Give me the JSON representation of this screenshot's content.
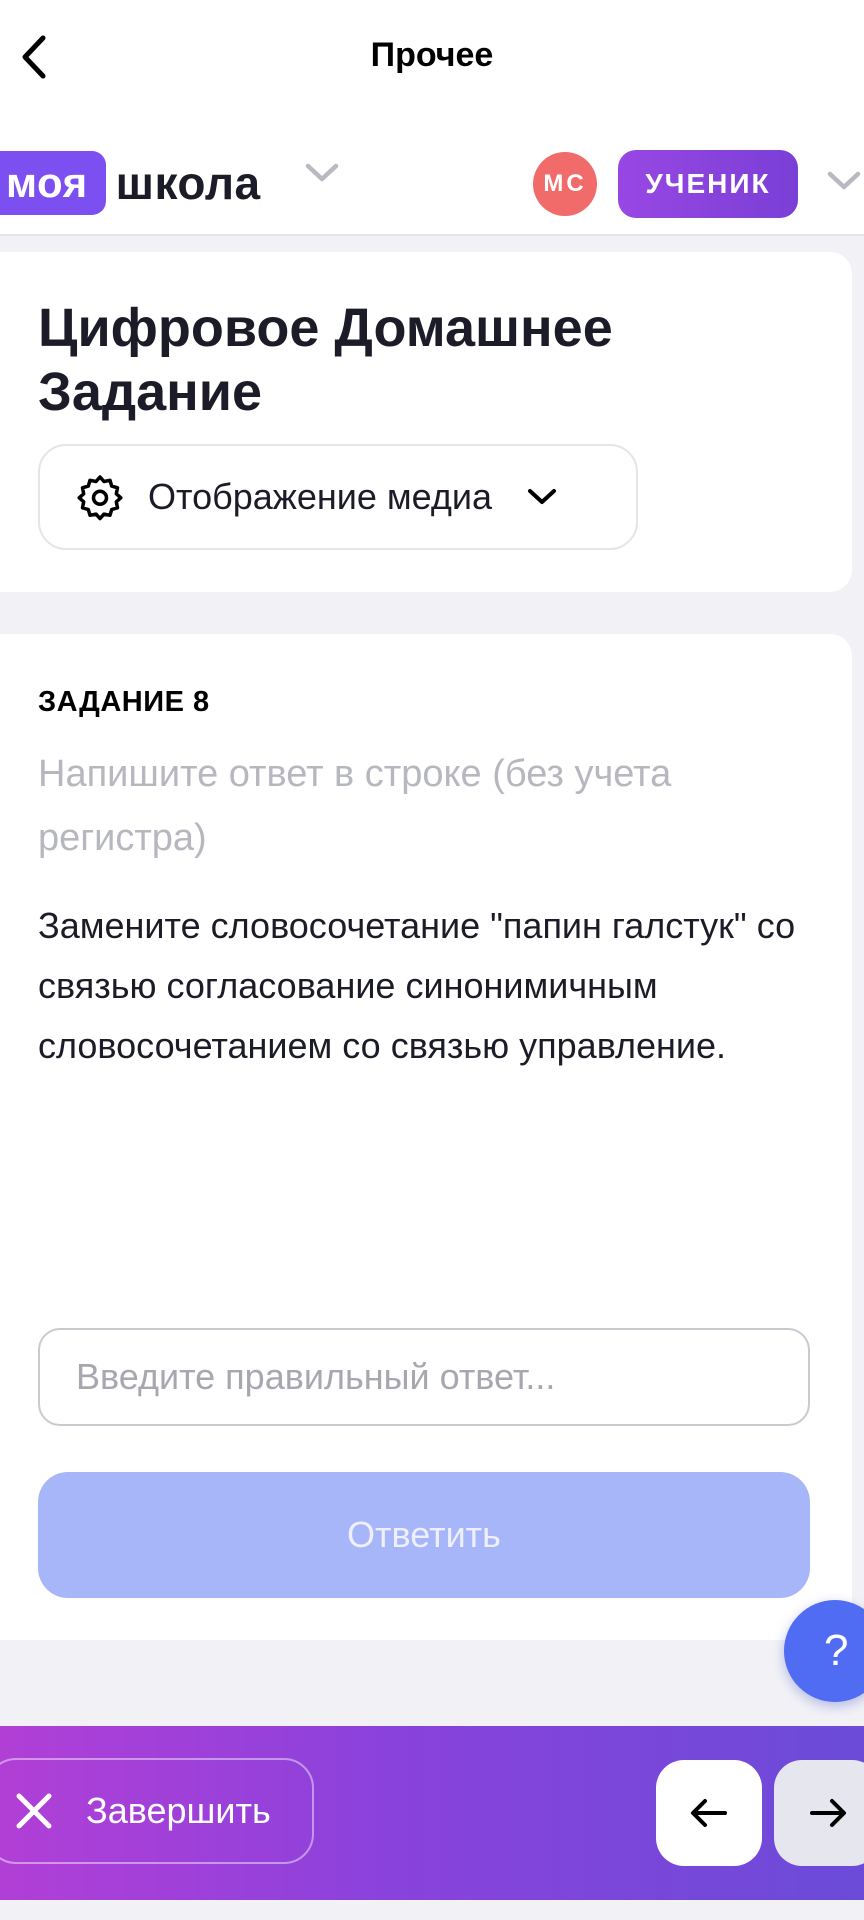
{
  "navbar": {
    "title": "Прочее"
  },
  "brand": {
    "logo_part1": "моя",
    "logo_part2": "школа",
    "avatar_initials": "МС",
    "role": "УЧЕНИК"
  },
  "header_card": {
    "title": "Цифровое Домашнее Задание",
    "media_select_label": "Отображение медиа"
  },
  "task": {
    "number_label": "ЗАДАНИЕ 8",
    "hint": "Напишите ответ в строке (без учета регистра)",
    "text": "Замените словосочетание \"папин галстук\" со связью согласование синонимичным словосочетанием со связью управление.",
    "answer_value": "",
    "answer_placeholder": "Введите правильный ответ...",
    "submit_label": "Ответить"
  },
  "help": {
    "label": "?"
  },
  "bottom_bar": {
    "finish_label": "Завершить"
  },
  "colors": {
    "brand_purple": "#7b4ff0",
    "role_badge": "#8b43dd",
    "avatar_bg": "#f26b6b",
    "submit_disabled": "#a7b6f8",
    "help_fab": "#4f6cf3",
    "bottom_gradient_start": "#b13fd6",
    "bottom_gradient_end": "#6b4bd8"
  },
  "icons": {
    "back": "chevron-left-icon",
    "logo_dropdown": "chevron-down-icon",
    "role_dropdown": "chevron-down-icon",
    "media_settings": "gear-icon",
    "media_dropdown": "chevron-down-icon",
    "finish": "close-icon",
    "prev": "arrow-left-icon",
    "next": "arrow-right-icon"
  }
}
